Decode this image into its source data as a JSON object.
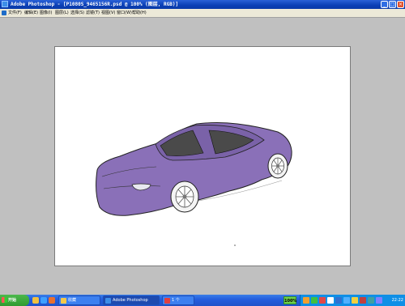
{
  "window": {
    "title": "Adobe Photoshop - [P1080S_9465156R.psd @ 100% (图层, RGB)]",
    "controls": [
      "_",
      "□",
      "×"
    ]
  },
  "menu": {
    "items": [
      "文件(F)",
      "编辑(E)",
      "图像(I)",
      "图层(L)",
      "选择(S)",
      "滤镜(T)",
      "视图(V)",
      "窗口(W)",
      "帮助(H)"
    ]
  },
  "canvas": {
    "car_body_color": "#8a70b8",
    "window_color": "#4a4a4a"
  },
  "taskbar": {
    "start_label": "开始",
    "buttons": [
      {
        "label": "收藏"
      },
      {
        "label": "Adobe Photoshop"
      },
      {
        "label": "1 个"
      }
    ],
    "zoom": "100%",
    "clock": "22:22"
  },
  "colors": {
    "titlebar": "#0a3fb5",
    "workspace": "#c0c0c0",
    "taskbar": "#245ede",
    "start": "#2f9a2f"
  }
}
